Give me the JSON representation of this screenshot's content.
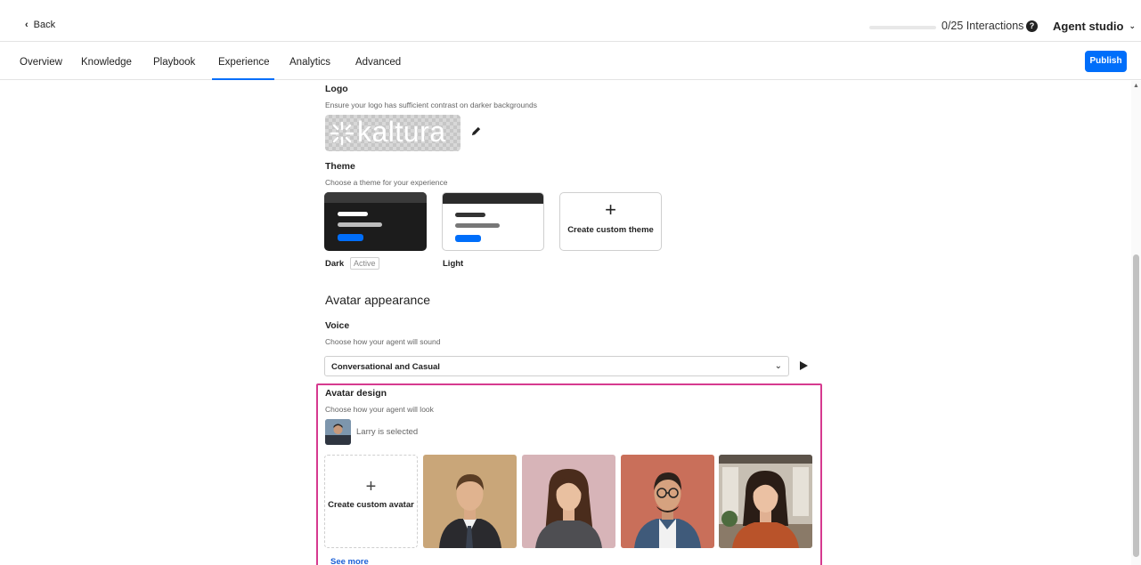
{
  "topbar": {
    "back_label": "Back",
    "interactions_label": "0/25 Interactions",
    "interactions_progress": 0,
    "help_icon": "question-circle-icon",
    "agent_studio_label": "Agent studio"
  },
  "tabs": [
    {
      "label": "Overview"
    },
    {
      "label": "Knowledge"
    },
    {
      "label": "Playbook"
    },
    {
      "label": "Experience",
      "active": true
    },
    {
      "label": "Analytics"
    },
    {
      "label": "Advanced"
    }
  ],
  "publish_label": "Publish",
  "logo": {
    "title": "Logo",
    "description": "Ensure your logo has sufficient contrast on darker backgrounds",
    "logo_text": "kaltura",
    "edit_icon": "pencil-icon"
  },
  "theme": {
    "title": "Theme",
    "description": "Choose a theme for your experience",
    "options": [
      {
        "name": "Dark",
        "badge": "Active"
      },
      {
        "name": "Light"
      }
    ],
    "custom_label": "Create custom theme"
  },
  "avatar_appearance": {
    "title": "Avatar appearance",
    "voice": {
      "title": "Voice",
      "description": "Choose how your agent will sound",
      "selected": "Conversational and Casual",
      "play_icon": "play-icon"
    },
    "design": {
      "title": "Avatar design",
      "description": "Choose how your agent will look",
      "selected_text": "Larry is selected",
      "custom_label": "Create custom avatar",
      "see_more": "See more"
    }
  },
  "colors": {
    "accent": "#006efa",
    "highlight_border": "#d63a8f",
    "link": "#1a5fd6"
  }
}
